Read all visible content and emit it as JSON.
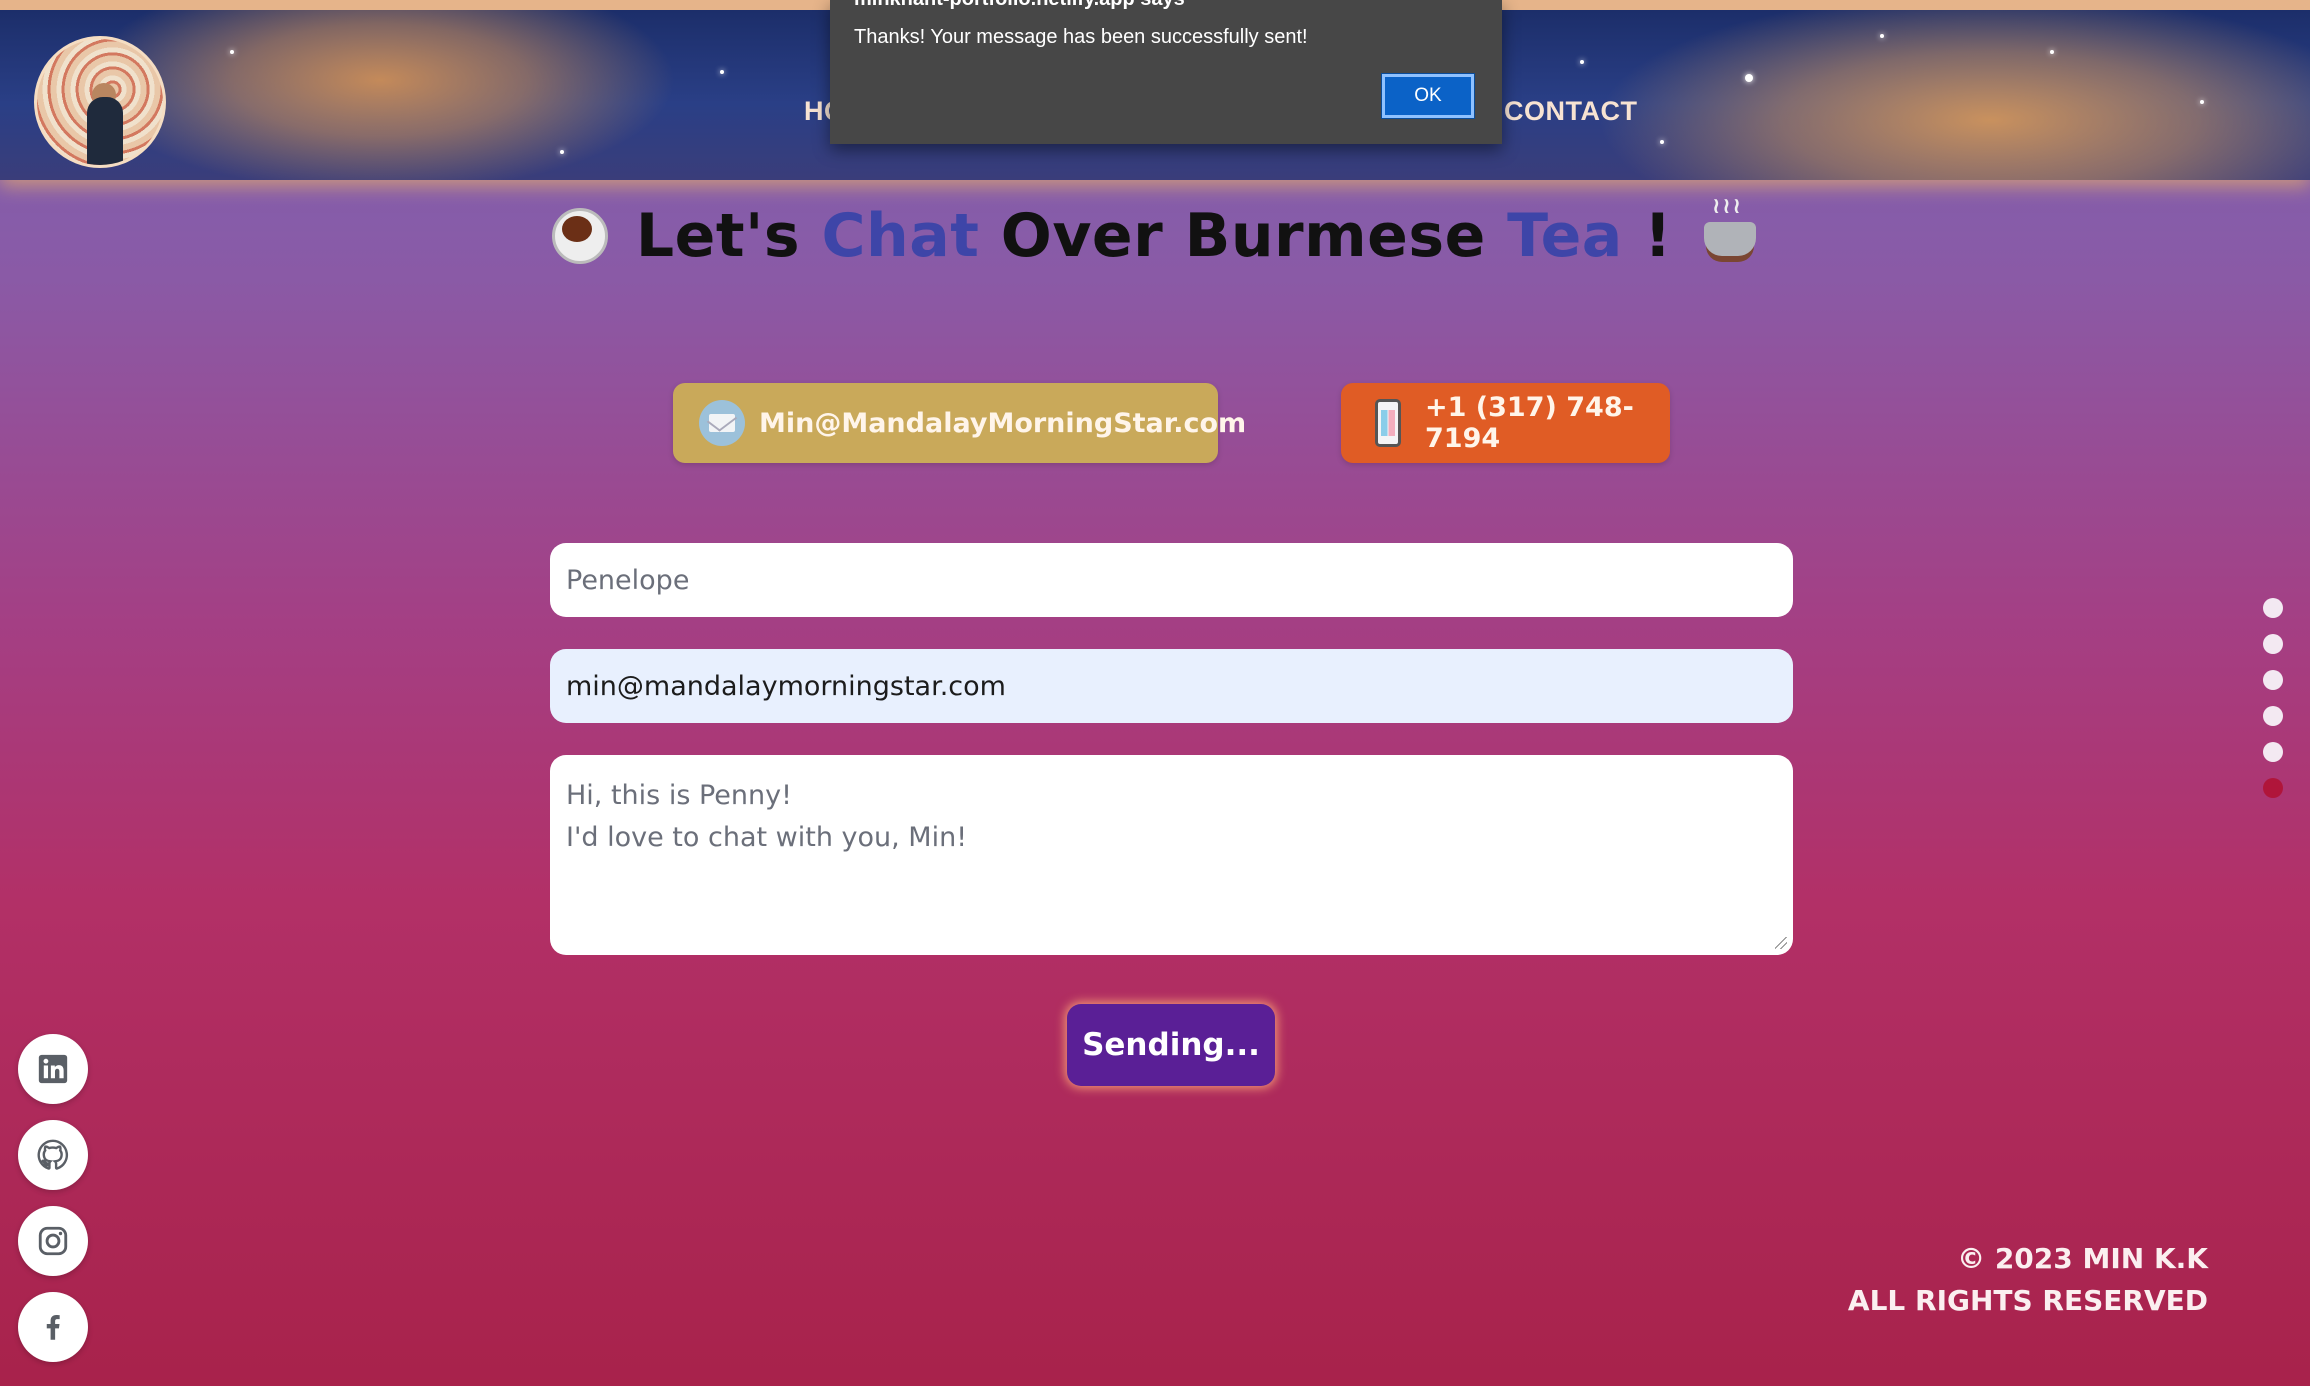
{
  "dialog": {
    "origin": "minkhant-portfolio.netlify.app says",
    "message": "Thanks! Your message has been successfully sent!",
    "ok_label": "OK"
  },
  "nav": {
    "home_partial": "HO",
    "contact": "CONTACT"
  },
  "title": {
    "part1": "Let's ",
    "chat": "Chat",
    "part2": " Over Burmese ",
    "tea": "Tea",
    "part3": " !"
  },
  "contact": {
    "email": "Min@MandalayMorningStar.com",
    "phone": "+1 (317) 748-7194"
  },
  "form": {
    "name_value": "Penelope",
    "email_value": "min@mandalaymorningstar.com",
    "message_lines": [
      "Hi, this is Penny!",
      "I'd love to chat with you, Min!"
    ],
    "submit_label": "Sending..."
  },
  "section_dots": {
    "count": 6,
    "active_index": 5
  },
  "social": [
    "linkedin-icon",
    "github-icon",
    "instagram-icon",
    "facebook-icon"
  ],
  "footer": {
    "copyright": "© 2023 MIN K.K",
    "rights": "ALL RIGHTS RESERVED"
  },
  "colors": {
    "email_button": "#c9a95a",
    "phone_button": "#e05c25",
    "submit_button": "#5a1f96",
    "accent_text": "#3e45a8",
    "active_dot": "#b0153a"
  }
}
